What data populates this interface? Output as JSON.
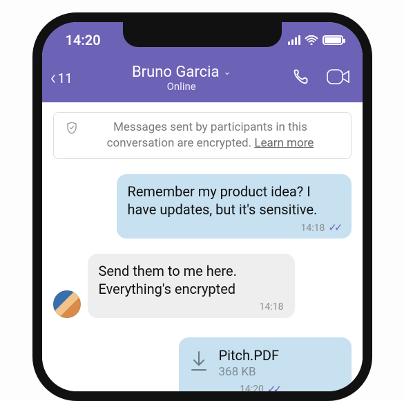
{
  "statusbar": {
    "time": "14:20"
  },
  "header": {
    "back_count": "11",
    "title": "Bruno Garcia",
    "subtitle": "Online"
  },
  "notice": {
    "text": "Messages sent by participants in this conversation are encrypted. ",
    "learn": "Learn more"
  },
  "messages": {
    "m1": {
      "text": "Remember my product idea? I have updates, but it's sensitive.",
      "time": "14:18"
    },
    "m2": {
      "text": "Send them to me here. Everything's encrypted",
      "time": "14:18"
    },
    "m3": {
      "filename": "Pitch.PDF",
      "filesize": "368 KB",
      "time": "14:20"
    }
  }
}
